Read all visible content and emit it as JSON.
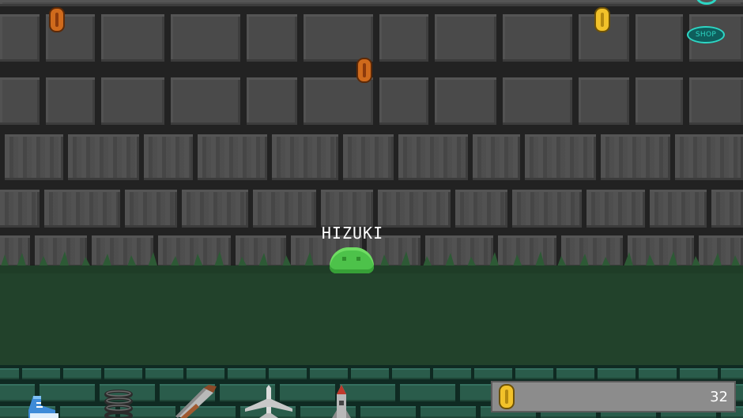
{
  "player": {
    "name": "HIZUKI"
  },
  "shop": {
    "label": "SHOP"
  },
  "hud": {
    "coin_count": "32"
  },
  "coins": [
    {
      "kind": "bronze"
    },
    {
      "kind": "bronze"
    },
    {
      "kind": "gold"
    }
  ],
  "items": [
    {
      "icon": "sneaker-icon"
    },
    {
      "icon": "spring-icon"
    },
    {
      "icon": "saw-icon"
    },
    {
      "icon": "airplane-icon"
    },
    {
      "icon": "rocket-icon"
    }
  ],
  "colors": {
    "ground": "#22422b",
    "slime": "#4dc24a",
    "shop_accent": "#2dd6c4",
    "coin_gold": "#f2c22a",
    "coin_bronze": "#cf6a1c"
  }
}
